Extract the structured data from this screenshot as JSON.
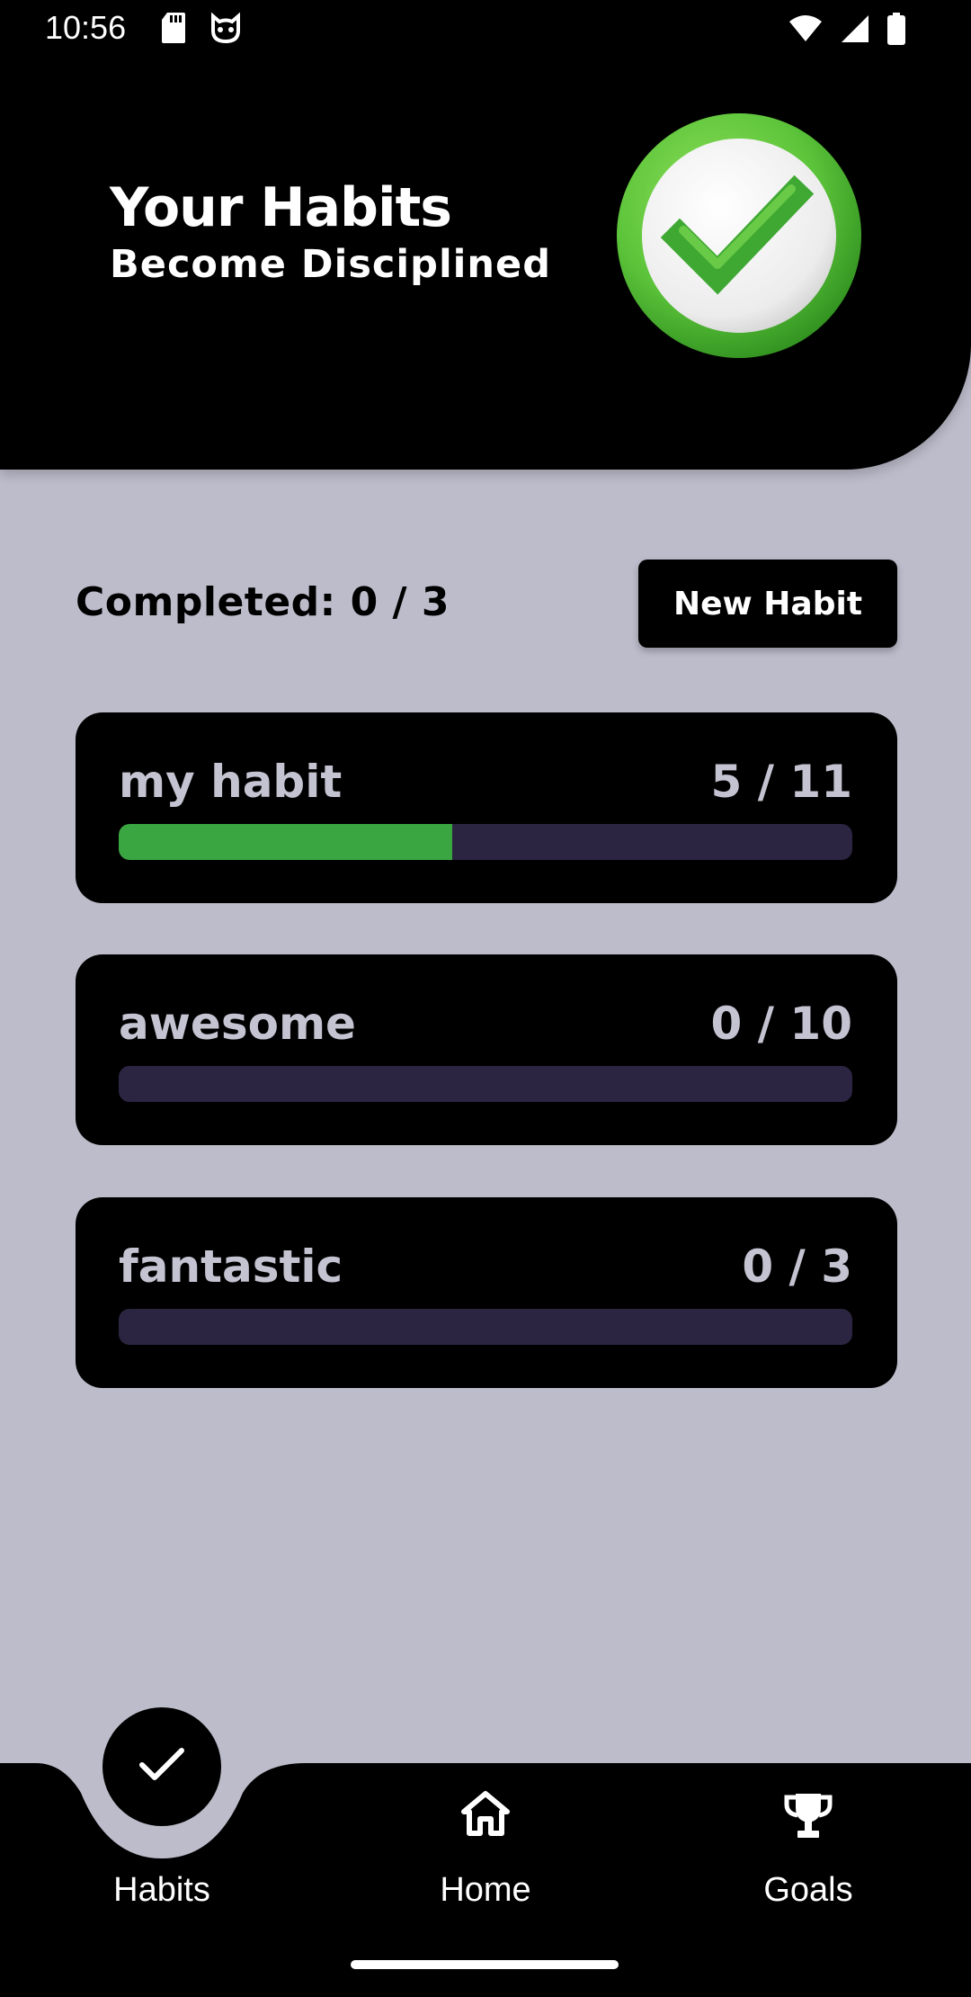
{
  "status_bar": {
    "time": "10:56",
    "left_icons": [
      "sd-card-icon",
      "cat-face-icon"
    ],
    "right_icons": [
      "wifi-icon",
      "signal-icon",
      "battery-icon"
    ]
  },
  "header": {
    "title": "Your Habits",
    "subtitle": "Become Disciplined",
    "badge_icon": "check-badge-icon"
  },
  "summary": {
    "completed_label": "Completed: 0 / 3",
    "new_habit_label": "New Habit"
  },
  "habits": [
    {
      "name": "my habit",
      "count": "5 / 11",
      "progress": 0.4545
    },
    {
      "name": "awesome",
      "count": "0 / 10",
      "progress": 0
    },
    {
      "name": "fantastic",
      "count": "0 / 3",
      "progress": 0
    }
  ],
  "nav": {
    "items": [
      {
        "label": "Habits",
        "icon": "check-icon",
        "active": true
      },
      {
        "label": "Home",
        "icon": "home-icon",
        "active": false
      },
      {
        "label": "Goals",
        "icon": "trophy-icon",
        "active": false
      }
    ]
  },
  "colors": {
    "background": "#bdbccb",
    "card": "#000000",
    "progress_fill": "#3aa641",
    "progress_track": "#2b2541",
    "card_text": "#c4c3d1",
    "badge_green": "#5cc43a"
  }
}
